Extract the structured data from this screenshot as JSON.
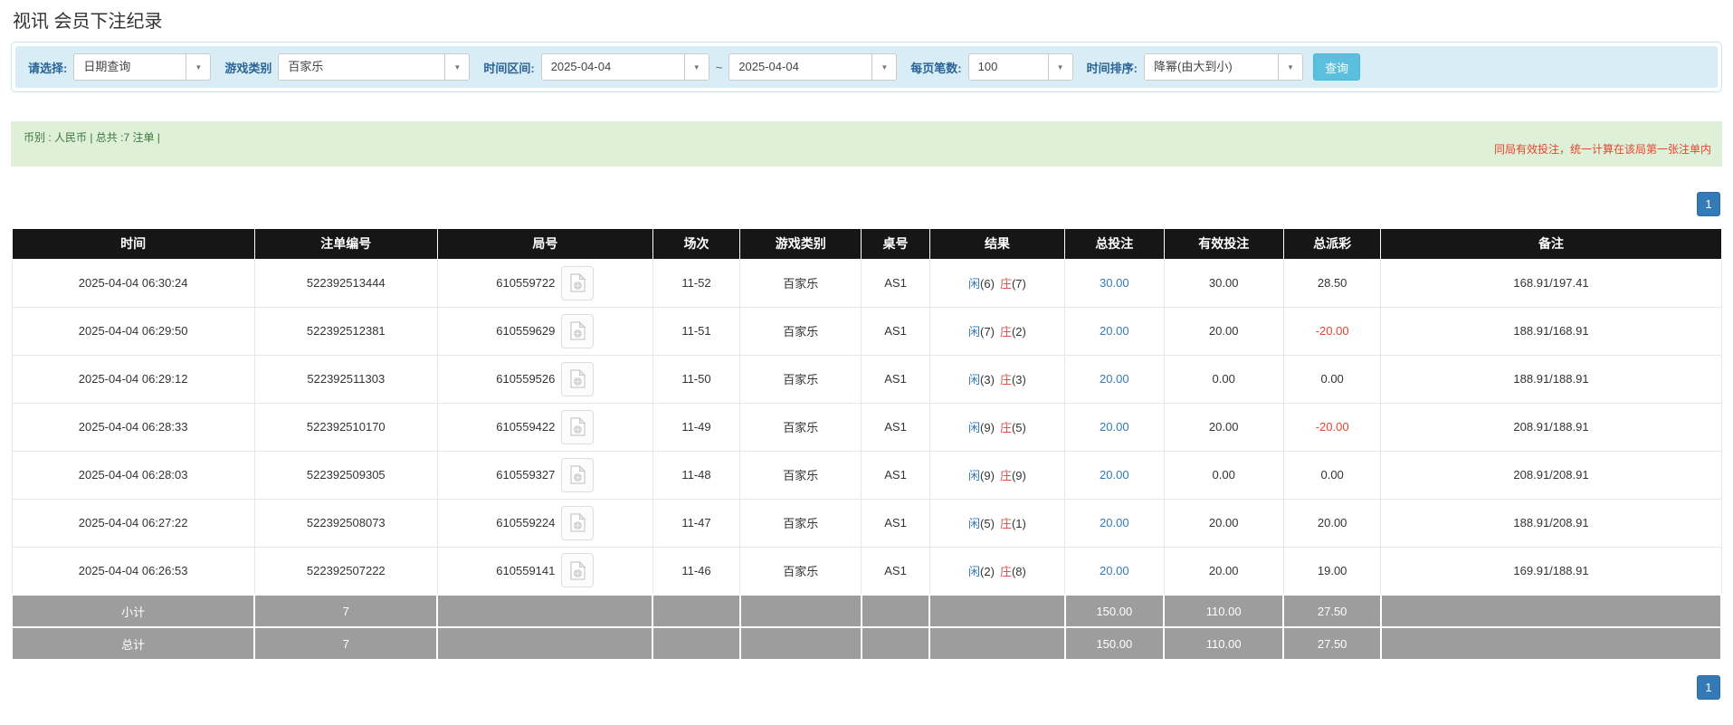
{
  "page": {
    "title": "视讯 会员下注纪录"
  },
  "icons": {
    "caret": "▼"
  },
  "colors": {
    "filter_bg": "#d9edf7",
    "label_blue": "#2a6496",
    "search_button_bg": "#5bc0de",
    "summary_bg": "#dff0d8",
    "summary_green": "#3c763d",
    "note_red": "#e8442d",
    "header_bg": "#161616",
    "player_blue": "#337ab7",
    "banker_red": "#d9534f",
    "negative_red": "#e8442d",
    "footer_bg": "#9d9d9d",
    "pager_blue": "#337ab7"
  },
  "filters": {
    "select_label": "请选择:",
    "select_value": "日期查询",
    "game_label": "游戏类别",
    "game_value": "百家乐",
    "range_label": "时间区间:",
    "date_from": "2025-04-04",
    "tilde": "~",
    "date_to": "2025-04-04",
    "per_page_label": "每页笔数:",
    "per_page_value": "100",
    "sort_label": "时间排序:",
    "sort_value": "降幂(由大到小)",
    "search_button": "查询"
  },
  "summary": {
    "left": "币别 : 人民币 | 总共 :7 注单 |",
    "right": "同局有效投注，统一计算在该局第一张注单内"
  },
  "pagination": {
    "page": "1"
  },
  "table": {
    "headers": [
      "时间",
      "注单编号",
      "局号",
      "场次",
      "游戏类别",
      "桌号",
      "结果",
      "总投注",
      "有效投注",
      "总派彩",
      "备注"
    ],
    "rows": [
      {
        "time": "2025-04-04 06:30:24",
        "bet_id": "522392513444",
        "round": "610559722",
        "session": "11-52",
        "game": "百家乐",
        "table_no": "AS1",
        "player_label": "闲",
        "player_score": "(6)",
        "banker_label": "庄",
        "banker_score": "(7)",
        "total_bet": "30.00",
        "valid_bet": "30.00",
        "payout": "28.50",
        "remark": "168.91/197.41"
      },
      {
        "time": "2025-04-04 06:29:50",
        "bet_id": "522392512381",
        "round": "610559629",
        "session": "11-51",
        "game": "百家乐",
        "table_no": "AS1",
        "player_label": "闲",
        "player_score": "(7)",
        "banker_label": "庄",
        "banker_score": "(2)",
        "total_bet": "20.00",
        "valid_bet": "20.00",
        "payout": "-20.00",
        "remark": "188.91/168.91"
      },
      {
        "time": "2025-04-04 06:29:12",
        "bet_id": "522392511303",
        "round": "610559526",
        "session": "11-50",
        "game": "百家乐",
        "table_no": "AS1",
        "player_label": "闲",
        "player_score": "(3)",
        "banker_label": "庄",
        "banker_score": "(3)",
        "total_bet": "20.00",
        "valid_bet": "0.00",
        "payout": "0.00",
        "remark": "188.91/188.91"
      },
      {
        "time": "2025-04-04 06:28:33",
        "bet_id": "522392510170",
        "round": "610559422",
        "session": "11-49",
        "game": "百家乐",
        "table_no": "AS1",
        "player_label": "闲",
        "player_score": "(9)",
        "banker_label": "庄",
        "banker_score": "(5)",
        "total_bet": "20.00",
        "valid_bet": "20.00",
        "payout": "-20.00",
        "remark": "208.91/188.91"
      },
      {
        "time": "2025-04-04 06:28:03",
        "bet_id": "522392509305",
        "round": "610559327",
        "session": "11-48",
        "game": "百家乐",
        "table_no": "AS1",
        "player_label": "闲",
        "player_score": "(9)",
        "banker_label": "庄",
        "banker_score": "(9)",
        "total_bet": "20.00",
        "valid_bet": "0.00",
        "payout": "0.00",
        "remark": "208.91/208.91"
      },
      {
        "time": "2025-04-04 06:27:22",
        "bet_id": "522392508073",
        "round": "610559224",
        "session": "11-47",
        "game": "百家乐",
        "table_no": "AS1",
        "player_label": "闲",
        "player_score": "(5)",
        "banker_label": "庄",
        "banker_score": "(1)",
        "total_bet": "20.00",
        "valid_bet": "20.00",
        "payout": "20.00",
        "remark": "188.91/208.91"
      },
      {
        "time": "2025-04-04 06:26:53",
        "bet_id": "522392507222",
        "round": "610559141",
        "session": "11-46",
        "game": "百家乐",
        "table_no": "AS1",
        "player_label": "闲",
        "player_score": "(2)",
        "banker_label": "庄",
        "banker_score": "(8)",
        "total_bet": "20.00",
        "valid_bet": "20.00",
        "payout": "19.00",
        "remark": "169.91/188.91"
      }
    ],
    "footer": [
      {
        "label": "小计",
        "count": "7",
        "total_bet": "150.00",
        "valid_bet": "110.00",
        "payout": "27.50"
      },
      {
        "label": "总计",
        "count": "7",
        "total_bet": "150.00",
        "valid_bet": "110.00",
        "payout": "27.50"
      }
    ]
  }
}
